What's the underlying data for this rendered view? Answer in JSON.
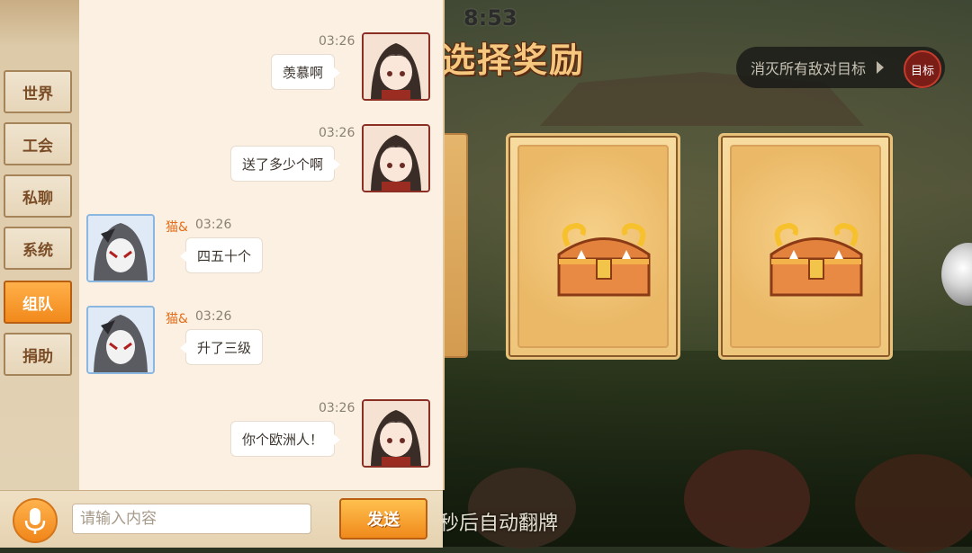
{
  "game": {
    "timer": "8:53",
    "title": "选择奖励",
    "objective": {
      "text": "消灭所有敌对目标",
      "badge": "目标"
    },
    "auto_flip_text": "秒后自动翻牌",
    "cards": [
      {
        "icon": "treasure-chest-icon"
      },
      {
        "icon": "treasure-chest-icon"
      }
    ]
  },
  "chat": {
    "tabs": [
      {
        "label": "世界",
        "active": false
      },
      {
        "label": "工会",
        "active": false
      },
      {
        "label": "私聊",
        "active": false
      },
      {
        "label": "系统",
        "active": false
      },
      {
        "label": "组队",
        "active": true
      },
      {
        "label": "捐助",
        "active": false
      }
    ],
    "messages": [
      {
        "side": "self",
        "time": "03:26",
        "name": "",
        "text": "羡慕啊"
      },
      {
        "side": "self",
        "time": "03:26",
        "name": "",
        "text": "送了多少个啊"
      },
      {
        "side": "other",
        "time": "03:26",
        "name": "猫&",
        "text": "四五十个"
      },
      {
        "side": "other",
        "time": "03:26",
        "name": "猫&",
        "text": "升了三级"
      },
      {
        "side": "self",
        "time": "03:26",
        "name": "",
        "text": "你个欧洲人！"
      }
    ],
    "input": {
      "placeholder": "请输入内容",
      "value": ""
    },
    "send_label": "发送"
  },
  "colors": {
    "accent_orange": "#f08a1c",
    "panel_bg": "#fbf0e1",
    "name_color": "#e36d1a"
  }
}
